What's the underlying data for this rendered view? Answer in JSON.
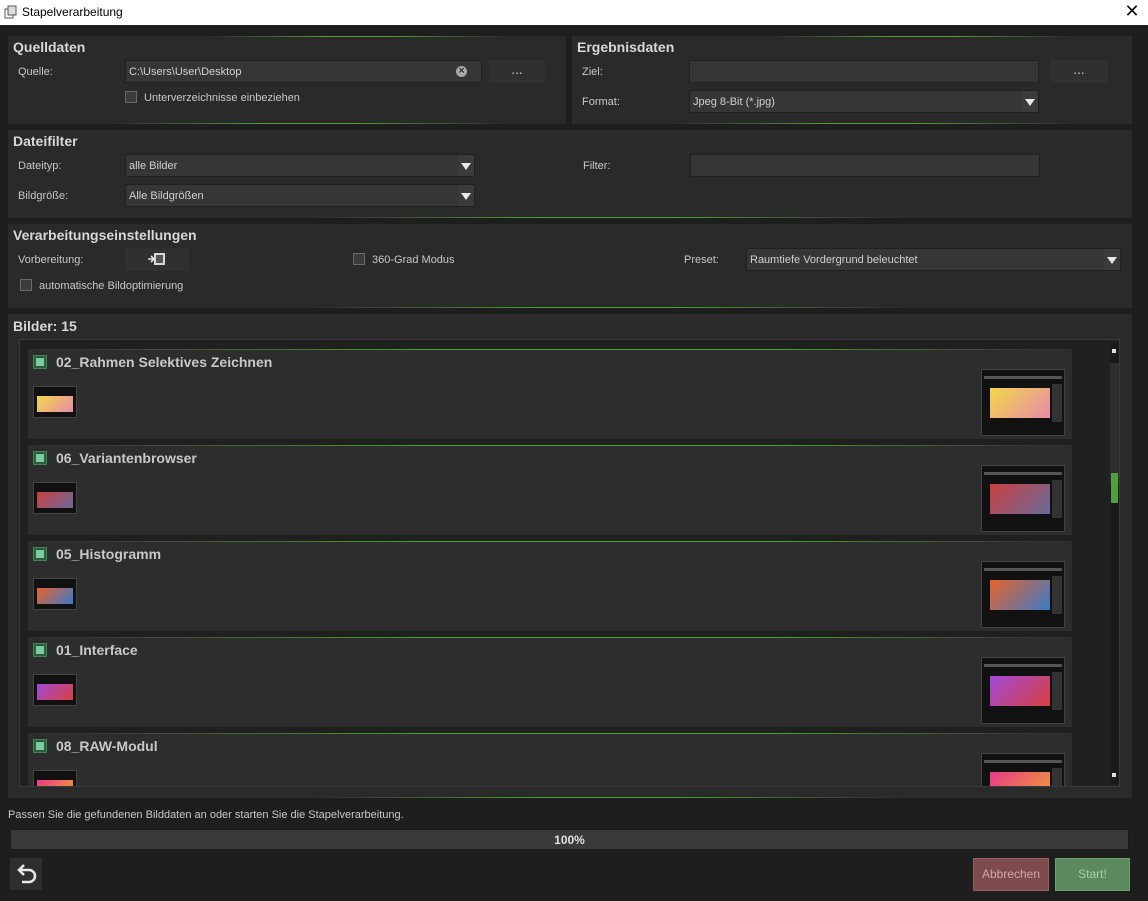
{
  "window": {
    "title": "Stapelverarbeitung",
    "close": "✕"
  },
  "source": {
    "title": "Quelldaten",
    "path_label": "Quelle:",
    "path_value": "C:\\Users\\User\\Desktop",
    "browse": "...",
    "subdirs_label": "Unterverzeichnisse einbeziehen",
    "subdirs_checked": false
  },
  "result": {
    "title": "Ergebnisdaten",
    "target_label": "Ziel:",
    "target_value": "",
    "browse": "...",
    "format_label": "Format:",
    "format_value": "Jpeg 8-Bit (*.jpg)"
  },
  "filter": {
    "title": "Dateifilter",
    "filetype_label": "Dateityp:",
    "filetype_value": "alle Bilder",
    "size_label": "Bildgröße:",
    "size_value": "Alle Bildgrößen",
    "filter_label": "Filter:",
    "filter_value": ""
  },
  "processing": {
    "title": "Verarbeitungseinstellungen",
    "prep_label": "Vorbereitung:",
    "mode360_label": "360-Grad Modus",
    "mode360_checked": false,
    "preset_label": "Preset:",
    "preset_value": "Raumtiefe Vordergrund beleuchtet",
    "auto_opt_label": "automatische Bildoptimierung",
    "auto_opt_checked": false
  },
  "images": {
    "title": "Bilder: 15",
    "items": [
      {
        "name": "02_Rahmen Selektives Zeichnen",
        "checked": true,
        "colors": [
          "#f2d84a",
          "#e88aa8"
        ]
      },
      {
        "name": "06_Variantenbrowser",
        "checked": true,
        "colors": [
          "#c84040",
          "#6a6a9a"
        ]
      },
      {
        "name": "05_Histogramm",
        "checked": true,
        "colors": [
          "#e8642c",
          "#3a7ac8"
        ]
      },
      {
        "name": "01_Interface",
        "checked": true,
        "colors": [
          "#a04ad8",
          "#d84040"
        ]
      },
      {
        "name": "08_RAW-Modul",
        "checked": true,
        "colors": [
          "#e83a8a",
          "#f0a030"
        ]
      }
    ]
  },
  "status": "Passen Sie die gefundenen Bilddaten an oder starten Sie die Stapelverarbeitung.",
  "progress": {
    "value": 100,
    "text": "100%"
  },
  "buttons": {
    "cancel": "Abbrechen",
    "start": "Start!",
    "back_icon": "undo-arrow-icon"
  },
  "colors": {
    "accent": "#4fa03c",
    "cancel_bg": "#8a4a4e",
    "start_bg": "#5a8f60"
  }
}
